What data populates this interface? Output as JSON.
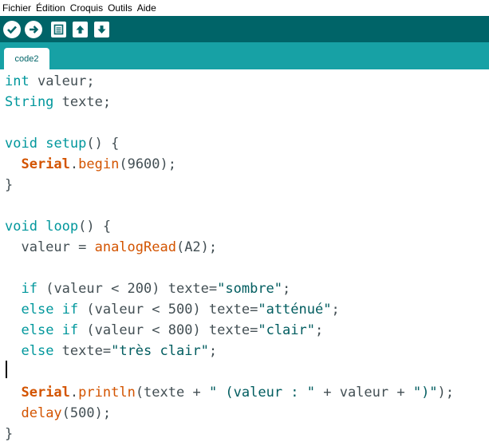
{
  "menubar": {
    "items": [
      "Fichier",
      "Édition",
      "Croquis",
      "Outils",
      "Aide"
    ]
  },
  "toolbar": {
    "buttons": [
      {
        "name": "verify",
        "icon": "checkmark-icon"
      },
      {
        "name": "upload",
        "icon": "arrow-right-icon"
      },
      {
        "name": "new",
        "icon": "new-file-icon"
      },
      {
        "name": "open",
        "icon": "arrow-up-icon"
      },
      {
        "name": "save",
        "icon": "arrow-down-icon"
      }
    ]
  },
  "tabs": [
    {
      "label": "code2",
      "active": true
    }
  ],
  "colors": {
    "toolbar": "#006468",
    "tabbar": "#17a1a5",
    "keyword": "#00979c",
    "function": "#d35400",
    "text": "#434f54"
  },
  "code": {
    "l1": {
      "a": "int",
      "b": " valeur;"
    },
    "l2": {
      "a": "String",
      "b": " texte;"
    },
    "l4": {
      "a": "void",
      "b": " ",
      "c": "setup",
      "d": "() {"
    },
    "l5": {
      "a": "  ",
      "b": "Serial",
      "c": ".",
      "d": "begin",
      "e": "(9600);"
    },
    "l6": {
      "a": "}"
    },
    "l8": {
      "a": "void",
      "b": " ",
      "c": "loop",
      "d": "() {"
    },
    "l9": {
      "a": "  valeur = ",
      "b": "analogRead",
      "c": "(A2);"
    },
    "l11": {
      "a": "  ",
      "b": "if",
      "c": " (valeur < 200) texte=",
      "d": "\"sombre\"",
      "e": ";"
    },
    "l12": {
      "a": "  ",
      "b": "else",
      "c": " ",
      "d": "if",
      "e": " (valeur < 500) texte=",
      "f": "\"atténué\"",
      "g": ";"
    },
    "l13": {
      "a": "  ",
      "b": "else",
      "c": " ",
      "d": "if",
      "e": " (valeur < 800) texte=",
      "f": "\"clair\"",
      "g": ";"
    },
    "l14": {
      "a": "  ",
      "b": "else",
      "c": " texte=",
      "d": "\"très clair\"",
      "e": ";"
    },
    "l16": {
      "a": "  ",
      "b": "Serial",
      "c": ".",
      "d": "println",
      "e": "(texte + ",
      "f": "\" (valeur : \"",
      "g": " + valeur + ",
      "h": "\")\"",
      "i": ");"
    },
    "l17": {
      "a": "  ",
      "b": "delay",
      "c": "(500);"
    },
    "l18": {
      "a": "}"
    }
  }
}
